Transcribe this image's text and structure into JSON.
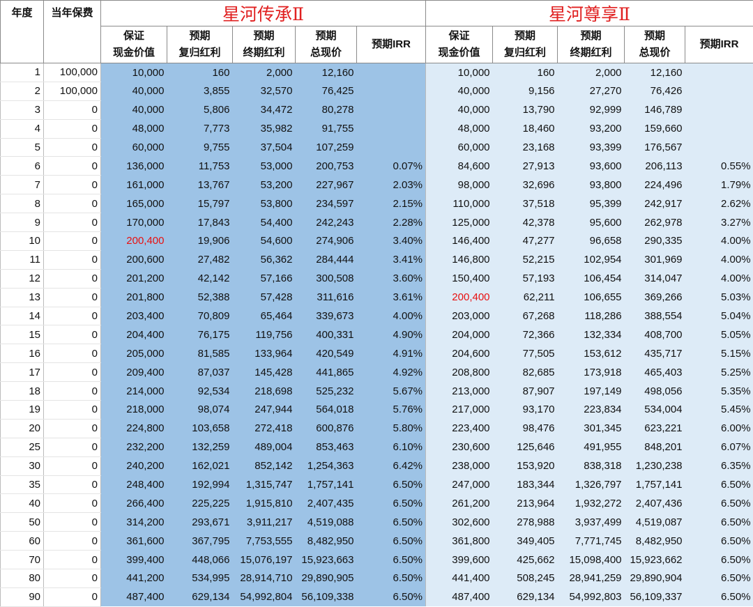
{
  "header": {
    "year": "年度",
    "premium": "当年保费",
    "products": [
      {
        "name": "星河传承Ⅱ",
        "cols": [
          [
            "保证",
            "现金价值"
          ],
          [
            "预期",
            "复归红利"
          ],
          [
            "预期",
            "终期红利"
          ],
          [
            "预期",
            "总现价"
          ],
          [
            "预期IRR"
          ]
        ]
      },
      {
        "name": "星河尊享Ⅱ",
        "cols": [
          [
            "保证",
            "现金价值"
          ],
          [
            "预期",
            "复归红利"
          ],
          [
            "预期",
            "终期红利"
          ],
          [
            "预期",
            "总现价"
          ],
          [
            "预期IRR"
          ]
        ]
      }
    ]
  },
  "colors": {
    "product_a_bg": "#9dc3e6",
    "product_b_bg": "#ddebf7",
    "highlight": "#e81010"
  },
  "rows": [
    {
      "y": "1",
      "p": "100,000",
      "a": [
        "10,000",
        "160",
        "2,000",
        "12,160",
        ""
      ],
      "b": [
        "10,000",
        "160",
        "2,000",
        "12,160",
        ""
      ]
    },
    {
      "y": "2",
      "p": "100,000",
      "a": [
        "40,000",
        "3,855",
        "32,570",
        "76,425",
        ""
      ],
      "b": [
        "40,000",
        "9,156",
        "27,270",
        "76,426",
        ""
      ]
    },
    {
      "y": "3",
      "p": "0",
      "a": [
        "40,000",
        "5,806",
        "34,472",
        "80,278",
        ""
      ],
      "b": [
        "40,000",
        "13,790",
        "92,999",
        "146,789",
        ""
      ]
    },
    {
      "y": "4",
      "p": "0",
      "a": [
        "48,000",
        "7,773",
        "35,982",
        "91,755",
        ""
      ],
      "b": [
        "48,000",
        "18,460",
        "93,200",
        "159,660",
        ""
      ]
    },
    {
      "y": "5",
      "p": "0",
      "a": [
        "60,000",
        "9,755",
        "37,504",
        "107,259",
        ""
      ],
      "b": [
        "60,000",
        "23,168",
        "93,399",
        "176,567",
        ""
      ]
    },
    {
      "y": "6",
      "p": "0",
      "a": [
        "136,000",
        "11,753",
        "53,000",
        "200,753",
        "0.07%"
      ],
      "b": [
        "84,600",
        "27,913",
        "93,600",
        "206,113",
        "0.55%"
      ]
    },
    {
      "y": "7",
      "p": "0",
      "a": [
        "161,000",
        "13,767",
        "53,200",
        "227,967",
        "2.03%"
      ],
      "b": [
        "98,000",
        "32,696",
        "93,800",
        "224,496",
        "1.79%"
      ]
    },
    {
      "y": "8",
      "p": "0",
      "a": [
        "165,000",
        "15,797",
        "53,800",
        "234,597",
        "2.15%"
      ],
      "b": [
        "110,000",
        "37,518",
        "95,399",
        "242,917",
        "2.62%"
      ]
    },
    {
      "y": "9",
      "p": "0",
      "a": [
        "170,000",
        "17,843",
        "54,400",
        "242,243",
        "2.28%"
      ],
      "b": [
        "125,000",
        "42,378",
        "95,600",
        "262,978",
        "3.27%"
      ]
    },
    {
      "y": "10",
      "p": "0",
      "a": [
        "200,400",
        "19,906",
        "54,600",
        "274,906",
        "3.40%"
      ],
      "b": [
        "146,400",
        "47,277",
        "96,658",
        "290,335",
        "4.00%"
      ],
      "redA": true
    },
    {
      "y": "11",
      "p": "0",
      "a": [
        "200,600",
        "27,482",
        "56,362",
        "284,444",
        "3.41%"
      ],
      "b": [
        "146,800",
        "52,215",
        "102,954",
        "301,969",
        "4.00%"
      ]
    },
    {
      "y": "12",
      "p": "0",
      "a": [
        "201,200",
        "42,142",
        "57,166",
        "300,508",
        "3.60%"
      ],
      "b": [
        "150,400",
        "57,193",
        "106,454",
        "314,047",
        "4.00%"
      ]
    },
    {
      "y": "13",
      "p": "0",
      "a": [
        "201,800",
        "52,388",
        "57,428",
        "311,616",
        "3.61%"
      ],
      "b": [
        "200,400",
        "62,211",
        "106,655",
        "369,266",
        "5.03%"
      ],
      "redB": true
    },
    {
      "y": "14",
      "p": "0",
      "a": [
        "203,400",
        "70,809",
        "65,464",
        "339,673",
        "4.00%"
      ],
      "b": [
        "203,000",
        "67,268",
        "118,286",
        "388,554",
        "5.04%"
      ]
    },
    {
      "y": "15",
      "p": "0",
      "a": [
        "204,400",
        "76,175",
        "119,756",
        "400,331",
        "4.90%"
      ],
      "b": [
        "204,000",
        "72,366",
        "132,334",
        "408,700",
        "5.05%"
      ]
    },
    {
      "y": "16",
      "p": "0",
      "a": [
        "205,000",
        "81,585",
        "133,964",
        "420,549",
        "4.91%"
      ],
      "b": [
        "204,600",
        "77,505",
        "153,612",
        "435,717",
        "5.15%"
      ]
    },
    {
      "y": "17",
      "p": "0",
      "a": [
        "209,400",
        "87,037",
        "145,428",
        "441,865",
        "4.92%"
      ],
      "b": [
        "208,800",
        "82,685",
        "173,918",
        "465,403",
        "5.25%"
      ]
    },
    {
      "y": "18",
      "p": "0",
      "a": [
        "214,000",
        "92,534",
        "218,698",
        "525,232",
        "5.67%"
      ],
      "b": [
        "213,000",
        "87,907",
        "197,149",
        "498,056",
        "5.35%"
      ]
    },
    {
      "y": "19",
      "p": "0",
      "a": [
        "218,000",
        "98,074",
        "247,944",
        "564,018",
        "5.76%"
      ],
      "b": [
        "217,000",
        "93,170",
        "223,834",
        "534,004",
        "5.45%"
      ]
    },
    {
      "y": "20",
      "p": "0",
      "a": [
        "224,800",
        "103,658",
        "272,418",
        "600,876",
        "5.80%"
      ],
      "b": [
        "223,400",
        "98,476",
        "301,345",
        "623,221",
        "6.00%"
      ]
    },
    {
      "y": "25",
      "p": "0",
      "a": [
        "232,200",
        "132,259",
        "489,004",
        "853,463",
        "6.10%"
      ],
      "b": [
        "230,600",
        "125,646",
        "491,955",
        "848,201",
        "6.07%"
      ]
    },
    {
      "y": "30",
      "p": "0",
      "a": [
        "240,200",
        "162,021",
        "852,142",
        "1,254,363",
        "6.42%"
      ],
      "b": [
        "238,000",
        "153,920",
        "838,318",
        "1,230,238",
        "6.35%"
      ]
    },
    {
      "y": "35",
      "p": "0",
      "a": [
        "248,400",
        "192,994",
        "1,315,747",
        "1,757,141",
        "6.50%"
      ],
      "b": [
        "247,000",
        "183,344",
        "1,326,797",
        "1,757,141",
        "6.50%"
      ]
    },
    {
      "y": "40",
      "p": "0",
      "a": [
        "266,400",
        "225,225",
        "1,915,810",
        "2,407,435",
        "6.50%"
      ],
      "b": [
        "261,200",
        "213,964",
        "1,932,272",
        "2,407,436",
        "6.50%"
      ]
    },
    {
      "y": "50",
      "p": "0",
      "a": [
        "314,200",
        "293,671",
        "3,911,217",
        "4,519,088",
        "6.50%"
      ],
      "b": [
        "302,600",
        "278,988",
        "3,937,499",
        "4,519,087",
        "6.50%"
      ]
    },
    {
      "y": "60",
      "p": "0",
      "a": [
        "361,600",
        "367,795",
        "7,753,555",
        "8,482,950",
        "6.50%"
      ],
      "b": [
        "361,800",
        "349,405",
        "7,771,745",
        "8,482,950",
        "6.50%"
      ]
    },
    {
      "y": "70",
      "p": "0",
      "a": [
        "399,400",
        "448,066",
        "15,076,197",
        "15,923,663",
        "6.50%"
      ],
      "b": [
        "399,600",
        "425,662",
        "15,098,400",
        "15,923,662",
        "6.50%"
      ]
    },
    {
      "y": "80",
      "p": "0",
      "a": [
        "441,200",
        "534,995",
        "28,914,710",
        "29,890,905",
        "6.50%"
      ],
      "b": [
        "441,400",
        "508,245",
        "28,941,259",
        "29,890,904",
        "6.50%"
      ]
    },
    {
      "y": "90",
      "p": "0",
      "a": [
        "487,400",
        "629,134",
        "54,992,804",
        "56,109,338",
        "6.50%"
      ],
      "b": [
        "487,400",
        "629,134",
        "54,992,803",
        "56,109,337",
        "6.50%"
      ]
    }
  ]
}
